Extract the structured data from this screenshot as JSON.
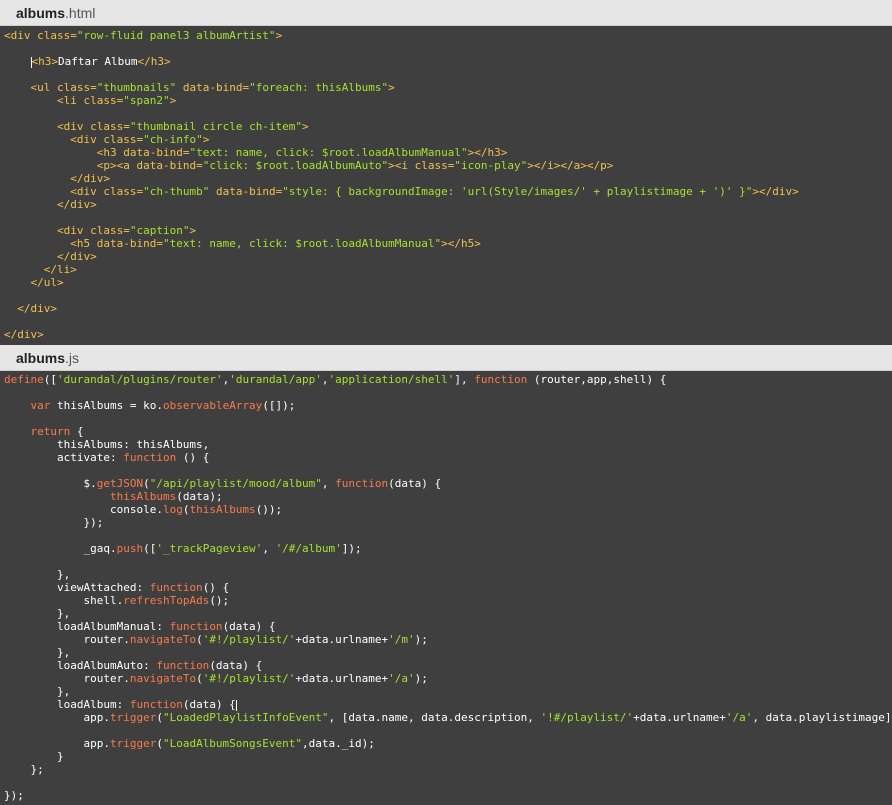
{
  "tabs": [
    {
      "base": "albums",
      "ext": ".html"
    },
    {
      "base": "albums",
      "ext": ".js"
    }
  ],
  "colors": {
    "editor_bg": "#3f3f3f",
    "tab_bg": "#e6e6e6",
    "tag": "#f2c14e",
    "string": "#a6e22e",
    "keyword": "#f97a4b",
    "plain": "#ffffff"
  },
  "html_lines": [
    [
      [
        "tag",
        "<div "
      ],
      [
        "attr",
        "class="
      ],
      [
        "str",
        "\"row-fluid panel3 albumArtist\""
      ],
      [
        "tag",
        ">"
      ]
    ],
    [],
    [
      [
        "plain",
        "    "
      ],
      [
        "cursor",
        ""
      ],
      [
        "tag",
        "<h3>"
      ],
      [
        "plain",
        "Daftar Album"
      ],
      [
        "tag",
        "</h3>"
      ]
    ],
    [],
    [
      [
        "plain",
        "    "
      ],
      [
        "tag",
        "<ul "
      ],
      [
        "attr",
        "class="
      ],
      [
        "str",
        "\"thumbnails\""
      ],
      [
        "attr",
        " data-bind="
      ],
      [
        "str",
        "\"foreach: thisAlbums\""
      ],
      [
        "tag",
        ">"
      ]
    ],
    [
      [
        "plain",
        "        "
      ],
      [
        "tag",
        "<li "
      ],
      [
        "attr",
        "class="
      ],
      [
        "str",
        "\"span2\""
      ],
      [
        "tag",
        ">"
      ]
    ],
    [],
    [
      [
        "plain",
        "        "
      ],
      [
        "tag",
        "<div "
      ],
      [
        "attr",
        "class="
      ],
      [
        "str",
        "\"thumbnail circle ch-item\""
      ],
      [
        "tag",
        ">"
      ]
    ],
    [
      [
        "plain",
        "          "
      ],
      [
        "tag",
        "<div "
      ],
      [
        "attr",
        "class="
      ],
      [
        "str",
        "\"ch-info\""
      ],
      [
        "tag",
        ">"
      ]
    ],
    [
      [
        "plain",
        "              "
      ],
      [
        "tag",
        "<h3 "
      ],
      [
        "attr",
        "data-bind="
      ],
      [
        "str",
        "\"text: name, click: $root.loadAlbumManual\""
      ],
      [
        "tag",
        "></h3>"
      ]
    ],
    [
      [
        "plain",
        "              "
      ],
      [
        "tag",
        "<p><a "
      ],
      [
        "attr",
        "data-bind="
      ],
      [
        "str",
        "\"click: $root.loadAlbumAuto\""
      ],
      [
        "tag",
        "><i "
      ],
      [
        "attr",
        "class="
      ],
      [
        "str",
        "\"icon-play\""
      ],
      [
        "tag",
        "></i></a></p>"
      ]
    ],
    [
      [
        "plain",
        "          "
      ],
      [
        "tag",
        "</div>"
      ]
    ],
    [
      [
        "plain",
        "          "
      ],
      [
        "tag",
        "<div "
      ],
      [
        "attr",
        "class="
      ],
      [
        "str",
        "\"ch-thumb\""
      ],
      [
        "attr",
        " data-bind="
      ],
      [
        "str",
        "\"style: { backgroundImage: 'url(Style/images/' + playlistimage + ')' }\""
      ],
      [
        "tag",
        "></div>"
      ]
    ],
    [
      [
        "plain",
        "        "
      ],
      [
        "tag",
        "</div>"
      ]
    ],
    [],
    [
      [
        "plain",
        "        "
      ],
      [
        "tag",
        "<div "
      ],
      [
        "attr",
        "class="
      ],
      [
        "str",
        "\"caption\""
      ],
      [
        "tag",
        ">"
      ]
    ],
    [
      [
        "plain",
        "          "
      ],
      [
        "tag",
        "<h5 "
      ],
      [
        "attr",
        "data-bind="
      ],
      [
        "str",
        "\"text: name, click: $root.loadAlbumManual\""
      ],
      [
        "tag",
        "></h5>"
      ]
    ],
    [
      [
        "plain",
        "        "
      ],
      [
        "tag",
        "</div>"
      ]
    ],
    [
      [
        "plain",
        "      "
      ],
      [
        "tag",
        "</li>"
      ]
    ],
    [
      [
        "plain",
        "    "
      ],
      [
        "tag",
        "</ul>"
      ]
    ],
    [],
    [
      [
        "plain",
        "  "
      ],
      [
        "tag",
        "</div>"
      ]
    ],
    [],
    [
      [
        "tag",
        "</div>"
      ]
    ]
  ],
  "js_lines": [
    [
      [
        "kw",
        "define"
      ],
      [
        "plain",
        "(["
      ],
      [
        "str",
        "'durandal/plugins/router'"
      ],
      [
        "plain",
        ","
      ],
      [
        "str",
        "'durandal/app'"
      ],
      [
        "plain",
        ","
      ],
      [
        "str",
        "'application/shell'"
      ],
      [
        "plain",
        "], "
      ],
      [
        "kw",
        "function"
      ],
      [
        "plain",
        " (router,app,shell) {"
      ]
    ],
    [],
    [
      [
        "plain",
        "    "
      ],
      [
        "kw",
        "var"
      ],
      [
        "plain",
        " thisAlbums = ko."
      ],
      [
        "fn",
        "observableArray"
      ],
      [
        "plain",
        "([]);"
      ]
    ],
    [],
    [
      [
        "plain",
        "    "
      ],
      [
        "kw",
        "return"
      ],
      [
        "plain",
        " {"
      ]
    ],
    [
      [
        "plain",
        "        thisAlbums: thisAlbums,"
      ]
    ],
    [
      [
        "plain",
        "        activate: "
      ],
      [
        "kw",
        "function"
      ],
      [
        "plain",
        " () {"
      ]
    ],
    [],
    [
      [
        "plain",
        "            $."
      ],
      [
        "fn",
        "getJSON"
      ],
      [
        "plain",
        "("
      ],
      [
        "str",
        "\"/api/playlist/mood/album\""
      ],
      [
        "plain",
        ", "
      ],
      [
        "kw",
        "function"
      ],
      [
        "plain",
        "(data) {"
      ]
    ],
    [
      [
        "plain",
        "                "
      ],
      [
        "fn",
        "thisAlbums"
      ],
      [
        "plain",
        "(data);"
      ]
    ],
    [
      [
        "plain",
        "                console."
      ],
      [
        "fn",
        "log"
      ],
      [
        "plain",
        "("
      ],
      [
        "fn",
        "thisAlbums"
      ],
      [
        "plain",
        "());"
      ]
    ],
    [
      [
        "plain",
        "            });"
      ]
    ],
    [],
    [
      [
        "plain",
        "            _gaq."
      ],
      [
        "fn",
        "push"
      ],
      [
        "plain",
        "(["
      ],
      [
        "str",
        "'_trackPageview'"
      ],
      [
        "plain",
        ", "
      ],
      [
        "str",
        "'/#/album'"
      ],
      [
        "plain",
        "]);"
      ]
    ],
    [],
    [
      [
        "plain",
        "        },"
      ]
    ],
    [
      [
        "plain",
        "        viewAttached: "
      ],
      [
        "kw",
        "function"
      ],
      [
        "plain",
        "() {"
      ]
    ],
    [
      [
        "plain",
        "            shell."
      ],
      [
        "fn",
        "refreshTopAds"
      ],
      [
        "plain",
        "();"
      ]
    ],
    [
      [
        "plain",
        "        },"
      ]
    ],
    [
      [
        "plain",
        "        loadAlbumManual: "
      ],
      [
        "kw",
        "function"
      ],
      [
        "plain",
        "(data) {"
      ]
    ],
    [
      [
        "plain",
        "            router."
      ],
      [
        "fn",
        "navigateTo"
      ],
      [
        "plain",
        "("
      ],
      [
        "str",
        "'#!/playlist/'"
      ],
      [
        "plain",
        "+data.urlname+"
      ],
      [
        "str",
        "'/m'"
      ],
      [
        "plain",
        ");"
      ]
    ],
    [
      [
        "plain",
        "        },"
      ]
    ],
    [
      [
        "plain",
        "        loadAlbumAuto: "
      ],
      [
        "kw",
        "function"
      ],
      [
        "plain",
        "(data) {"
      ]
    ],
    [
      [
        "plain",
        "            router."
      ],
      [
        "fn",
        "navigateTo"
      ],
      [
        "plain",
        "("
      ],
      [
        "str",
        "'#!/playlist/'"
      ],
      [
        "plain",
        "+data.urlname+"
      ],
      [
        "str",
        "'/a'"
      ],
      [
        "plain",
        ");"
      ]
    ],
    [
      [
        "plain",
        "        },"
      ]
    ],
    [
      [
        "plain",
        "        loadAlbum: "
      ],
      [
        "kw",
        "function"
      ],
      [
        "plain",
        "(data) {"
      ],
      [
        "cursor",
        ""
      ]
    ],
    [
      [
        "plain",
        "            app."
      ],
      [
        "fn",
        "trigger"
      ],
      [
        "plain",
        "("
      ],
      [
        "str",
        "\"LoadedPlaylistInfoEvent\""
      ],
      [
        "plain",
        ", [data.name, data.description, "
      ],
      [
        "str",
        "'!#/playlist/'"
      ],
      [
        "plain",
        "+data.urlname+"
      ],
      [
        "str",
        "'/a'"
      ],
      [
        "plain",
        ", data.playlistimage]);"
      ]
    ],
    [],
    [
      [
        "plain",
        "            app."
      ],
      [
        "fn",
        "trigger"
      ],
      [
        "plain",
        "("
      ],
      [
        "str",
        "\"LoadAlbumSongsEvent\""
      ],
      [
        "plain",
        ",data._id);"
      ]
    ],
    [
      [
        "plain",
        "        }"
      ]
    ],
    [
      [
        "plain",
        "    };"
      ]
    ],
    [],
    [
      [
        "plain",
        "});"
      ]
    ]
  ]
}
